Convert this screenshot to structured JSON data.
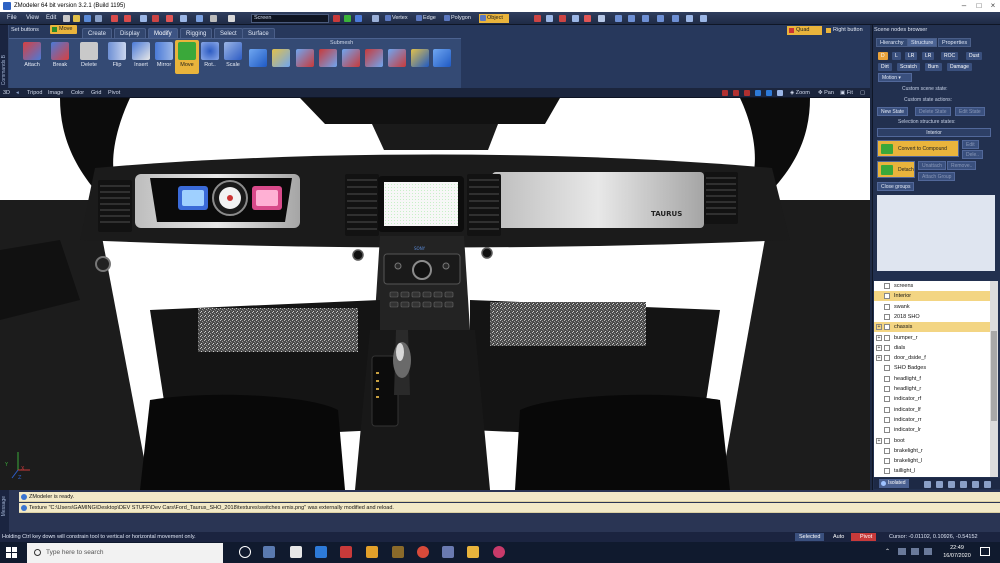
{
  "window": {
    "title": "ZModeler 64 bit version 3.2.1 (Build 1195)",
    "controls": [
      "–",
      "□",
      "×"
    ]
  },
  "menu": {
    "items": [
      "File",
      "View",
      "Edit"
    ],
    "coordinate_system": "Screen",
    "selection_modes": [
      "Vertex",
      "Edge",
      "Polygon",
      "Object"
    ],
    "active_mode": "Object"
  },
  "command_panel": {
    "side_label": "Commands B",
    "set_buttons": "Set buttons",
    "current_tool": "Move",
    "tabs": [
      "Create",
      "Display",
      "Modify",
      "Rigging",
      "Select",
      "Surface"
    ],
    "active_tab": "Modify",
    "tools": [
      "Attach",
      "Break",
      "Delete",
      "Flip",
      "Insert",
      "Mirror",
      "Move",
      "Rot..",
      "Scale"
    ],
    "active_tool": "Move",
    "submesh_label": "Submesh",
    "quad_buttons": [
      "Quad",
      "Right button"
    ]
  },
  "viewport_bar": {
    "items": [
      "3D",
      "Tripod",
      "Image",
      "Color",
      "Grid",
      "Pivot"
    ],
    "right_items": [
      "Zoom",
      "Pan",
      "Fit"
    ]
  },
  "viewport": {
    "dash_badge": "TAURUS",
    "radio_brand": "SONY"
  },
  "scene_browser": {
    "title": "Scene nodes browser",
    "tabs": [
      "Hierarchy",
      "Structure",
      "Properties"
    ],
    "active_tab": "Structure",
    "state_buttons_row1": [
      "D",
      "L",
      "LR",
      "LR",
      "ROC",
      "Dust"
    ],
    "state_buttons_row2": [
      "Dirt",
      "Scratch",
      "Burn",
      "Damage"
    ],
    "motion_dropdown": "Motion",
    "custom_scene_state": "Custom scene state:",
    "custom_state_actions": "Custom state actions:",
    "state_action_buttons": [
      "New State",
      "Delete State",
      "Edit State"
    ],
    "selection_structure_states": "Selection structure states:",
    "selection_value": "Interior",
    "convert_button": "Convert to Compound",
    "convert_side": [
      "Edit",
      "Dele.."
    ],
    "detach_button": "Detach",
    "detach_side": [
      "Unattach",
      "Remove.."
    ],
    "small_buttons": [
      "Unattach",
      "Attach Group"
    ],
    "close_groups": "Close groups",
    "tree": [
      {
        "label": "screens",
        "highlight": false,
        "expand": ""
      },
      {
        "label": "Interior",
        "highlight": true,
        "expand": ""
      },
      {
        "label": "swank",
        "highlight": false,
        "expand": ""
      },
      {
        "label": "2018 SHO",
        "highlight": false,
        "expand": ""
      },
      {
        "label": "chassis",
        "highlight": true,
        "expand": "+"
      },
      {
        "label": "bumper_r",
        "highlight": false,
        "expand": "+"
      },
      {
        "label": "dials",
        "highlight": false,
        "expand": "+"
      },
      {
        "label": "door_dside_f",
        "highlight": false,
        "expand": "+"
      },
      {
        "label": "SHO Badges",
        "highlight": false,
        "expand": ""
      },
      {
        "label": "headlight_f",
        "highlight": false,
        "expand": ""
      },
      {
        "label": "headlight_r",
        "highlight": false,
        "expand": ""
      },
      {
        "label": "indicator_rf",
        "highlight": false,
        "expand": ""
      },
      {
        "label": "indicator_lf",
        "highlight": false,
        "expand": ""
      },
      {
        "label": "indicator_rr",
        "highlight": false,
        "expand": ""
      },
      {
        "label": "indicator_lr",
        "highlight": false,
        "expand": ""
      },
      {
        "label": "boot",
        "highlight": false,
        "expand": "+"
      },
      {
        "label": "brakelight_r",
        "highlight": false,
        "expand": ""
      },
      {
        "label": "brakelight_l",
        "highlight": false,
        "expand": ""
      },
      {
        "label": "taillight_l",
        "highlight": false,
        "expand": ""
      }
    ],
    "isolated": "Isolated"
  },
  "log": {
    "side_label": "Message",
    "lines": [
      "ZModeler is ready.",
      "Texture \"C:\\Users\\GAMING\\Desktop\\DEV STUFF\\Dev Cars\\Ford_Taurus_SHO_2018\\textures\\switches emis.png\" was externally modified and reload."
    ]
  },
  "status": {
    "hint": "Holding Ctrl key down will constrain tool to vertical or horizontal movement only.",
    "selected": "Selected",
    "auto": "Auto",
    "pivot": "Pivot",
    "cursor": "Cursor: -0.01102, 0.10926, -0.54152"
  },
  "taskbar": {
    "search_placeholder": "Type here to search",
    "time": "22:49",
    "date": "16/07/2020"
  },
  "colors": {
    "accent": "#e9b43c",
    "panel": "#27385c",
    "panel_dark": "#1b253d",
    "viewport_bg": "#ffffff"
  }
}
